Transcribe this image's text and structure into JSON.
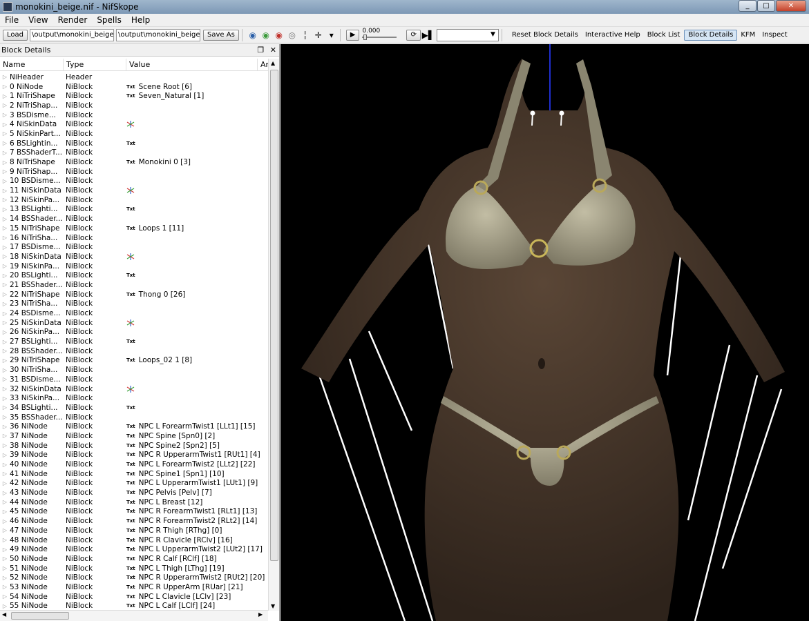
{
  "window": {
    "title": "monokini_beige.nif - NifSkope"
  },
  "menu": [
    "File",
    "View",
    "Render",
    "Spells",
    "Help"
  ],
  "toolbar": {
    "load_label": "Load",
    "load_path": "\\output\\monokini_beige.nif",
    "save_path": "\\output\\monokini_beige.nif",
    "save_as_label": "Save As",
    "anim_time": "0.000",
    "reset_block_details": "Reset Block Details",
    "interactive_help": "Interactive Help",
    "block_list": "Block List",
    "block_details": "Block Details",
    "kfm": "KFM",
    "inspect": "Inspect"
  },
  "panel": {
    "title": "Block Details",
    "columns": [
      "Name",
      "Type",
      "Value",
      "Ar"
    ],
    "rows": [
      {
        "name": "NiHeader",
        "type": "Header",
        "icon": "",
        "value": ""
      },
      {
        "name": "0 NiNode",
        "type": "NiBlock",
        "icon": "txt",
        "value": "Scene Root [6]"
      },
      {
        "name": "1 NiTriShape",
        "type": "NiBlock",
        "icon": "txt",
        "value": "Seven_Natural [1]"
      },
      {
        "name": "2 NiTriShap...",
        "type": "NiBlock",
        "icon": "",
        "value": ""
      },
      {
        "name": "3 BSDisme...",
        "type": "NiBlock",
        "icon": "",
        "value": ""
      },
      {
        "name": "4 NiSkinData",
        "type": "NiBlock",
        "icon": "axes",
        "value": ""
      },
      {
        "name": "5 NiSkinPart...",
        "type": "NiBlock",
        "icon": "",
        "value": ""
      },
      {
        "name": "6 BSLightin...",
        "type": "NiBlock",
        "icon": "txt",
        "value": ""
      },
      {
        "name": "7 BSShaderT...",
        "type": "NiBlock",
        "icon": "",
        "value": ""
      },
      {
        "name": "8 NiTriShape",
        "type": "NiBlock",
        "icon": "txt",
        "value": "Monokini 0 [3]"
      },
      {
        "name": "9 NiTriShap...",
        "type": "NiBlock",
        "icon": "",
        "value": ""
      },
      {
        "name": "10 BSDisme...",
        "type": "NiBlock",
        "icon": "",
        "value": ""
      },
      {
        "name": "11 NiSkinData",
        "type": "NiBlock",
        "icon": "axes",
        "value": ""
      },
      {
        "name": "12 NiSkinPa...",
        "type": "NiBlock",
        "icon": "",
        "value": ""
      },
      {
        "name": "13 BSLighti...",
        "type": "NiBlock",
        "icon": "txt",
        "value": ""
      },
      {
        "name": "14 BSShader...",
        "type": "NiBlock",
        "icon": "",
        "value": ""
      },
      {
        "name": "15 NiTriShape",
        "type": "NiBlock",
        "icon": "txt",
        "value": "Loops 1 [11]"
      },
      {
        "name": "16 NiTriSha...",
        "type": "NiBlock",
        "icon": "",
        "value": ""
      },
      {
        "name": "17 BSDisme...",
        "type": "NiBlock",
        "icon": "",
        "value": ""
      },
      {
        "name": "18 NiSkinData",
        "type": "NiBlock",
        "icon": "axes",
        "value": ""
      },
      {
        "name": "19 NiSkinPa...",
        "type": "NiBlock",
        "icon": "",
        "value": ""
      },
      {
        "name": "20 BSLighti...",
        "type": "NiBlock",
        "icon": "txt",
        "value": ""
      },
      {
        "name": "21 BSShader...",
        "type": "NiBlock",
        "icon": "",
        "value": ""
      },
      {
        "name": "22 NiTriShape",
        "type": "NiBlock",
        "icon": "txt",
        "value": "Thong 0 [26]"
      },
      {
        "name": "23 NiTriSha...",
        "type": "NiBlock",
        "icon": "",
        "value": ""
      },
      {
        "name": "24 BSDisme...",
        "type": "NiBlock",
        "icon": "",
        "value": ""
      },
      {
        "name": "25 NiSkinData",
        "type": "NiBlock",
        "icon": "axes",
        "value": ""
      },
      {
        "name": "26 NiSkinPa...",
        "type": "NiBlock",
        "icon": "",
        "value": ""
      },
      {
        "name": "27 BSLighti...",
        "type": "NiBlock",
        "icon": "txt",
        "value": ""
      },
      {
        "name": "28 BSShader...",
        "type": "NiBlock",
        "icon": "",
        "value": ""
      },
      {
        "name": "29 NiTriShape",
        "type": "NiBlock",
        "icon": "txt",
        "value": "Loops_02 1 [8]"
      },
      {
        "name": "30 NiTriSha...",
        "type": "NiBlock",
        "icon": "",
        "value": ""
      },
      {
        "name": "31 BSDisme...",
        "type": "NiBlock",
        "icon": "",
        "value": ""
      },
      {
        "name": "32 NiSkinData",
        "type": "NiBlock",
        "icon": "axes",
        "value": ""
      },
      {
        "name": "33 NiSkinPa...",
        "type": "NiBlock",
        "icon": "",
        "value": ""
      },
      {
        "name": "34 BSLighti...",
        "type": "NiBlock",
        "icon": "txt",
        "value": ""
      },
      {
        "name": "35 BSShader...",
        "type": "NiBlock",
        "icon": "",
        "value": ""
      },
      {
        "name": "36 NiNode",
        "type": "NiBlock",
        "icon": "txt",
        "value": "NPC L ForearmTwist1 [LLt1] [15]"
      },
      {
        "name": "37 NiNode",
        "type": "NiBlock",
        "icon": "txt",
        "value": "NPC Spine [Spn0] [2]"
      },
      {
        "name": "38 NiNode",
        "type": "NiBlock",
        "icon": "txt",
        "value": "NPC Spine2 [Spn2] [5]"
      },
      {
        "name": "39 NiNode",
        "type": "NiBlock",
        "icon": "txt",
        "value": "NPC R UpperarmTwist1 [RUt1] [4]"
      },
      {
        "name": "40 NiNode",
        "type": "NiBlock",
        "icon": "txt",
        "value": "NPC L ForearmTwist2 [LLt2] [22]"
      },
      {
        "name": "41 NiNode",
        "type": "NiBlock",
        "icon": "txt",
        "value": "NPC Spine1 [Spn1] [10]"
      },
      {
        "name": "42 NiNode",
        "type": "NiBlock",
        "icon": "txt",
        "value": "NPC L UpperarmTwist1 [LUt1] [9]"
      },
      {
        "name": "43 NiNode",
        "type": "NiBlock",
        "icon": "txt",
        "value": "NPC Pelvis [Pelv] [7]"
      },
      {
        "name": "44 NiNode",
        "type": "NiBlock",
        "icon": "txt",
        "value": "NPC L Breast [12]"
      },
      {
        "name": "45 NiNode",
        "type": "NiBlock",
        "icon": "txt",
        "value": "NPC R ForearmTwist1 [RLt1] [13]"
      },
      {
        "name": "46 NiNode",
        "type": "NiBlock",
        "icon": "txt",
        "value": "NPC R ForearmTwist2 [RLt2] [14]"
      },
      {
        "name": "47 NiNode",
        "type": "NiBlock",
        "icon": "txt",
        "value": "NPC R Thigh [RThg] [0]"
      },
      {
        "name": "48 NiNode",
        "type": "NiBlock",
        "icon": "txt",
        "value": "NPC R Clavicle [RClv] [16]"
      },
      {
        "name": "49 NiNode",
        "type": "NiBlock",
        "icon": "txt",
        "value": "NPC L UpperarmTwist2 [LUt2] [17]"
      },
      {
        "name": "50 NiNode",
        "type": "NiBlock",
        "icon": "txt",
        "value": "NPC R Calf [RClf] [18]"
      },
      {
        "name": "51 NiNode",
        "type": "NiBlock",
        "icon": "txt",
        "value": "NPC L Thigh [LThg] [19]"
      },
      {
        "name": "52 NiNode",
        "type": "NiBlock",
        "icon": "txt",
        "value": "NPC R UpperarmTwist2 [RUt2] [20]"
      },
      {
        "name": "53 NiNode",
        "type": "NiBlock",
        "icon": "txt",
        "value": "NPC R UpperArm [RUar] [21]"
      },
      {
        "name": "54 NiNode",
        "type": "NiBlock",
        "icon": "txt",
        "value": "NPC L Clavicle [LClv] [23]"
      },
      {
        "name": "55 NiNode",
        "type": "NiBlock",
        "icon": "txt",
        "value": "NPC L Calf [LClf] [24]"
      }
    ]
  },
  "colors": {
    "viewport_bg": "#000000",
    "skin": "#4a3a2e",
    "garment": "#a8a28a",
    "bone_line": "#ffffff",
    "axis_line": "#1f2fd0"
  }
}
